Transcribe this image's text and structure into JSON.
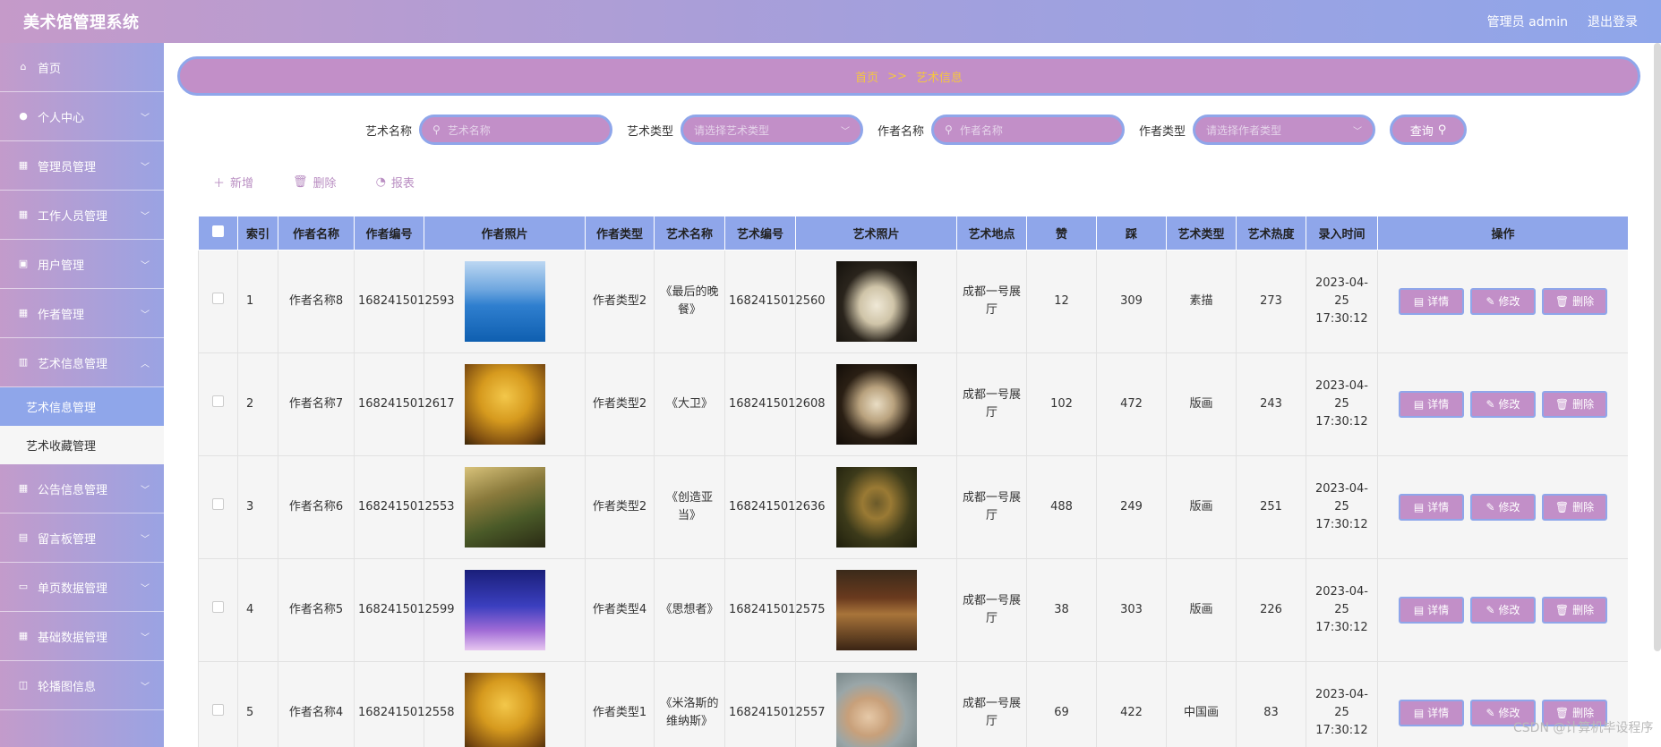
{
  "header": {
    "title": "美术馆管理系统",
    "user_label": "管理员 admin",
    "logout_label": "退出登录"
  },
  "sidebar": {
    "items": [
      {
        "label": "首页",
        "icon": "home-icon",
        "has_children": false
      },
      {
        "label": "个人中心",
        "icon": "user-icon",
        "has_children": true
      },
      {
        "label": "管理员管理",
        "icon": "grid-icon",
        "has_children": true
      },
      {
        "label": "工作人员管理",
        "icon": "grid-icon",
        "has_children": true
      },
      {
        "label": "用户管理",
        "icon": "clipboard-icon",
        "has_children": true
      },
      {
        "label": "作者管理",
        "icon": "table-icon",
        "has_children": true
      },
      {
        "label": "艺术信息管理",
        "icon": "chart-icon",
        "has_children": true
      },
      {
        "label": "公告信息管理",
        "icon": "grid-icon",
        "has_children": true
      },
      {
        "label": "留言板管理",
        "icon": "note-icon",
        "has_children": true
      },
      {
        "label": "单页数据管理",
        "icon": "monitor-icon",
        "has_children": true
      },
      {
        "label": "基础数据管理",
        "icon": "grid-icon",
        "has_children": true
      },
      {
        "label": "轮播图信息",
        "icon": "carousel-icon",
        "has_children": true
      }
    ],
    "sub_items": [
      {
        "label": "艺术信息管理",
        "active": true
      },
      {
        "label": "艺术收藏管理",
        "active": false
      }
    ]
  },
  "breadcrumb": {
    "home": "首页",
    "sep": ">>",
    "current": "艺术信息"
  },
  "search": {
    "art_name_label": "艺术名称",
    "art_name_placeholder": "艺术名称",
    "art_type_label": "艺术类型",
    "art_type_placeholder": "请选择艺术类型",
    "author_name_label": "作者名称",
    "author_name_placeholder": "作者名称",
    "author_type_label": "作者类型",
    "author_type_placeholder": "请选择作者类型",
    "query_label": "查询"
  },
  "actions": {
    "add": "新增",
    "delete": "删除",
    "report": "报表"
  },
  "table": {
    "headers": [
      "索引",
      "作者名称",
      "作者编号",
      "作者照片",
      "作者类型",
      "艺术名称",
      "艺术编号",
      "艺术照片",
      "艺术地点",
      "赞",
      "踩",
      "艺术类型",
      "艺术热度",
      "录入时间",
      "操作"
    ],
    "op_labels": {
      "detail": "详情",
      "edit": "修改",
      "remove": "删除"
    },
    "rows": [
      {
        "index": "1",
        "author": "作者名称8",
        "author_no": "1682415012593",
        "author_type": "作者类型2",
        "art_name": "《最后的晚餐》",
        "art_no": "1682415012560",
        "place": "成都一号展厅",
        "like": "12",
        "dislike": "309",
        "art_type": "素描",
        "heat": "273",
        "time": "2023-04-25 17:30:12"
      },
      {
        "index": "2",
        "author": "作者名称7",
        "author_no": "1682415012617",
        "author_type": "作者类型2",
        "art_name": "《大卫》",
        "art_no": "1682415012608",
        "place": "成都一号展厅",
        "like": "102",
        "dislike": "472",
        "art_type": "版画",
        "heat": "243",
        "time": "2023-04-25 17:30:12"
      },
      {
        "index": "3",
        "author": "作者名称6",
        "author_no": "1682415012553",
        "author_type": "作者类型2",
        "art_name": "《创造亚当》",
        "art_no": "1682415012636",
        "place": "成都一号展厅",
        "like": "488",
        "dislike": "249",
        "art_type": "版画",
        "heat": "251",
        "time": "2023-04-25 17:30:12"
      },
      {
        "index": "4",
        "author": "作者名称5",
        "author_no": "1682415012599",
        "author_type": "作者类型4",
        "art_name": "《思想者》",
        "art_no": "1682415012575",
        "place": "成都一号展厅",
        "like": "38",
        "dislike": "303",
        "art_type": "版画",
        "heat": "226",
        "time": "2023-04-25 17:30:12"
      },
      {
        "index": "5",
        "author": "作者名称4",
        "author_no": "1682415012558",
        "author_type": "作者类型1",
        "art_name": "《米洛斯的维纳斯》",
        "art_no": "1682415012557",
        "place": "成都一号展厅",
        "like": "69",
        "dislike": "422",
        "art_type": "中国画",
        "heat": "83",
        "time": "2023-04-25 17:30:12"
      }
    ]
  },
  "watermark": "CSDN @计算机毕设程序"
}
